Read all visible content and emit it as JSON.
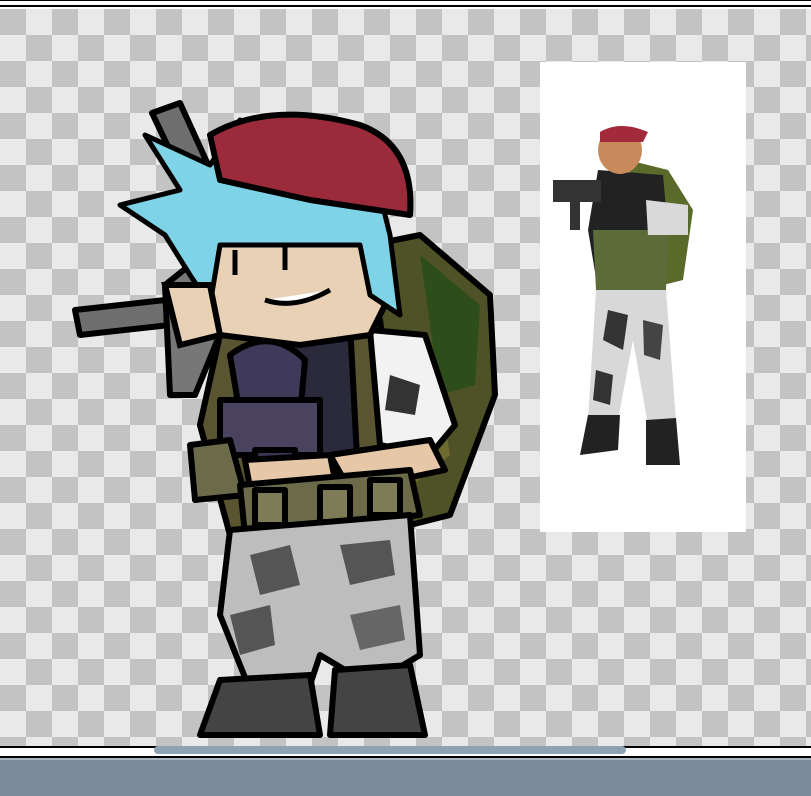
{
  "window": {
    "accent": "#7b8b9a",
    "scroll_thumb_color": "#8fa2b4"
  },
  "canvas": {
    "background": "transparency-checkerboard",
    "checker_light": "#e9e9e9",
    "checker_dark": "#c3c3c3"
  },
  "sprites": {
    "main": {
      "icon": "cartoon-soldier-sprite",
      "colors": {
        "beret": "#9b2b3a",
        "hair": "#7fd3e6",
        "backpack": "#4c4f25",
        "pants": "#b9b9b9"
      }
    },
    "reference": {
      "icon": "3d-soldier-reference",
      "panel_color": "#ffffff"
    }
  }
}
